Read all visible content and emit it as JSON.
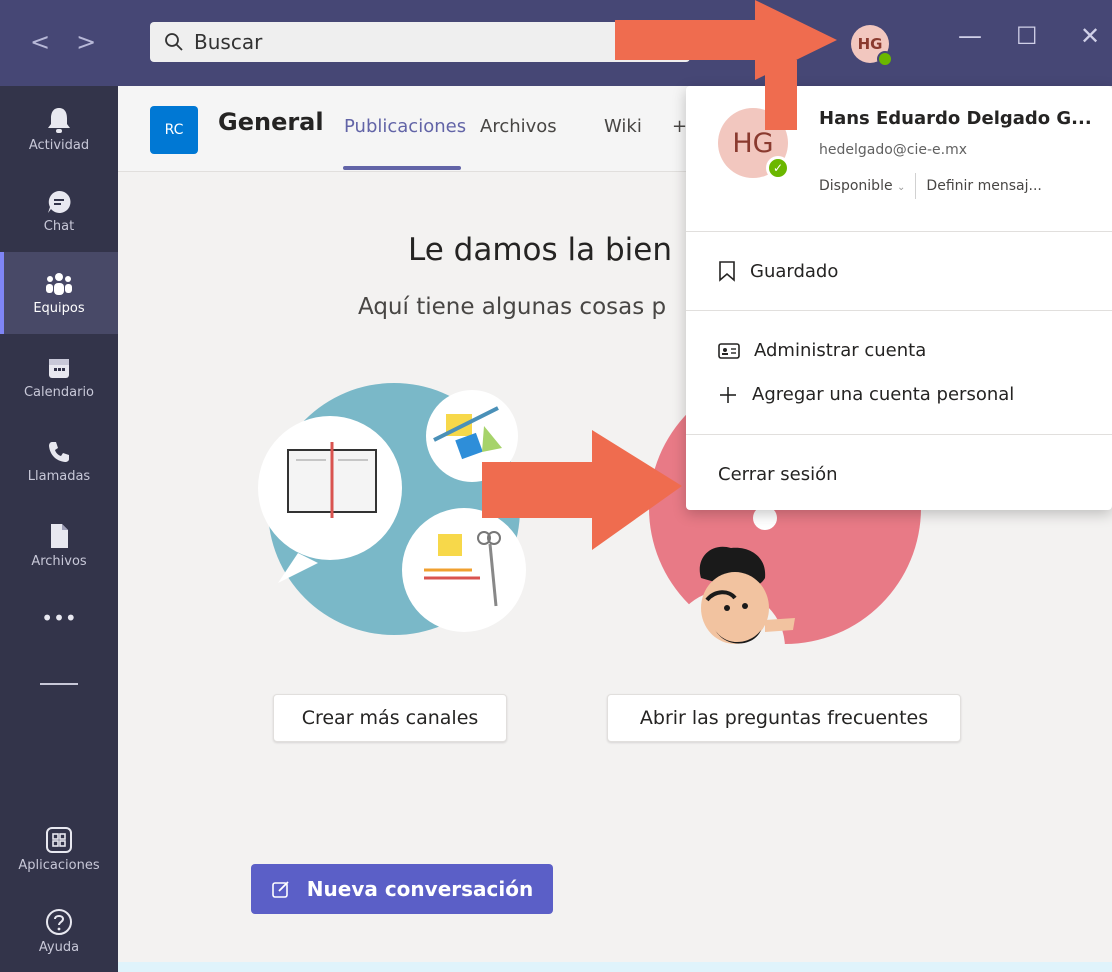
{
  "titlebar": {
    "back_glyph": "<",
    "forward_glyph": ">",
    "search_placeholder": "Buscar",
    "avatar_initials": "HG",
    "minimize_glyph": "—",
    "maximize_glyph": "☐",
    "close_glyph": "✕"
  },
  "rail": {
    "items": [
      {
        "label": "Actividad",
        "icon": "bell-icon"
      },
      {
        "label": "Chat",
        "icon": "chat-icon"
      },
      {
        "label": "Equipos",
        "icon": "teams-icon",
        "active": true
      },
      {
        "label": "Calendario",
        "icon": "calendar-icon"
      },
      {
        "label": "Llamadas",
        "icon": "phone-icon"
      },
      {
        "label": "Archivos",
        "icon": "file-icon"
      }
    ],
    "more_label": "•••",
    "apps_label": "Aplicaciones",
    "help_label": "Ayuda"
  },
  "channel": {
    "team_initials": "RC",
    "title": "General",
    "tabs": [
      "Publicaciones",
      "Archivos",
      "Wiki",
      "+"
    ]
  },
  "main": {
    "welcome_title": "Le damos la bien",
    "welcome_subtitle": "Aquí tiene algunas cosas p",
    "create_channels_button": "Crear más canales",
    "open_faq_button": "Abrir las preguntas frecuentes",
    "new_conversation_button": "Nueva conversación"
  },
  "profile_menu": {
    "initials": "HG",
    "name": "Hans Eduardo Delgado G...",
    "email": "hedelgado@cie-e.mx",
    "status": "Disponible",
    "status_chevron": "⌄",
    "status_message": "Definir mensaj...",
    "saved": "Guardado",
    "manage_account": "Administrar cuenta",
    "add_personal_account": "Agregar una cuenta personal",
    "sign_out": "Cerrar sesión"
  },
  "colors": {
    "titlebar": "#464775",
    "rail": "#33344a",
    "accent": "#6264a7",
    "annotation_arrow": "#ef6c4f",
    "available": "#6bb700"
  }
}
